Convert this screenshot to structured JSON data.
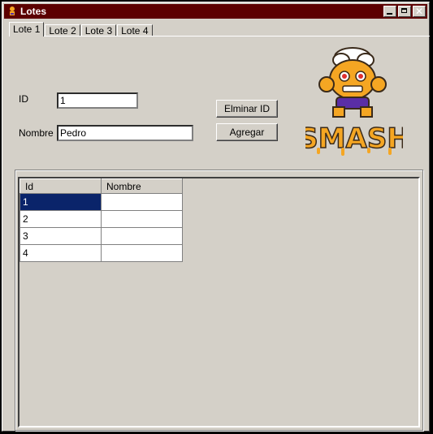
{
  "window": {
    "title": "Lotes",
    "icon": "app-icon",
    "buttons": [
      "minimize-icon",
      "maximize-icon",
      "close-icon"
    ],
    "close_glyph": "✕"
  },
  "tabs": [
    {
      "label": "Lote 1",
      "active": true
    },
    {
      "label": "Lote 2",
      "active": false
    },
    {
      "label": "Lote 3",
      "active": false
    },
    {
      "label": "Lote 4",
      "active": false
    }
  ],
  "form": {
    "id_label": "ID",
    "id_value": "1",
    "nombre_label": "Nombre",
    "nombre_value": "Pedro",
    "eliminar_label": "Elminar ID",
    "agregar_label": "Agregar"
  },
  "logo": {
    "text": "SMASH",
    "colors": {
      "orange": "#f5a623",
      "purple": "#5a2ea6",
      "outline": "#3a2a1a"
    }
  },
  "grid": {
    "columns": [
      "Id",
      "Nombre"
    ],
    "rows": [
      {
        "id": "1",
        "nombre": "",
        "selected": true
      },
      {
        "id": "2",
        "nombre": "",
        "selected": false
      },
      {
        "id": "3",
        "nombre": "",
        "selected": false
      },
      {
        "id": "4",
        "nombre": "",
        "selected": false
      }
    ]
  },
  "colors": {
    "titlebar": "#5c0000",
    "face": "#d4d0c8",
    "selection": "#0a246a"
  }
}
